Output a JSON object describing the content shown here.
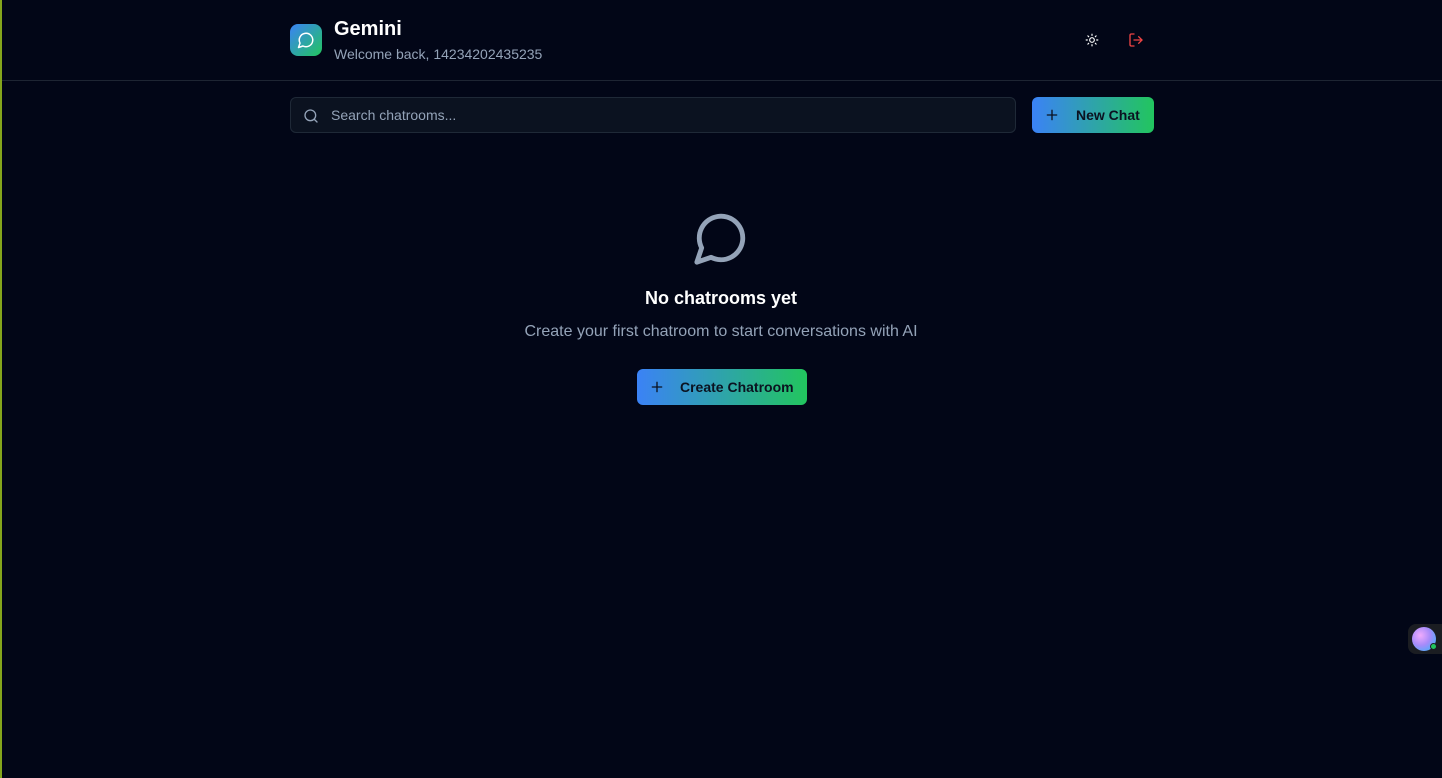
{
  "app": {
    "title": "Gemini",
    "welcome": "Welcome back, 14234202435235"
  },
  "header": {
    "theme_icon": "sun-icon",
    "logout_icon": "logout-icon"
  },
  "search": {
    "placeholder": "Search chatrooms...",
    "value": ""
  },
  "toolbar": {
    "new_chat_label": "New Chat"
  },
  "empty_state": {
    "icon": "message-circle-icon",
    "title": "No chatrooms yet",
    "description": "Create your first chatroom to start conversations with AI",
    "button_label": "Create Chatroom"
  },
  "colors": {
    "background": "#020617",
    "accent_start": "#3b82f6",
    "accent_end": "#22c55e",
    "logout": "#ef4444"
  }
}
